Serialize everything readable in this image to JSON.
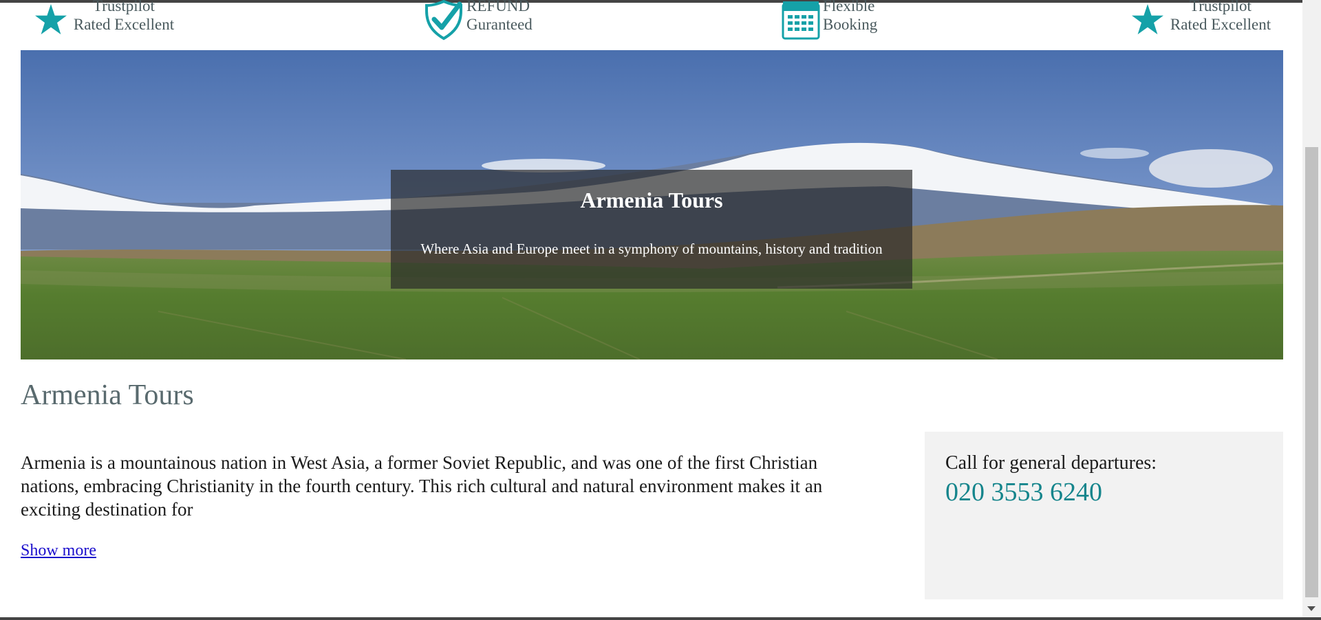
{
  "trust_bar": {
    "items": [
      {
        "icon": "star-icon",
        "line1": "Trustpilot",
        "line2": "Rated Excellent"
      },
      {
        "icon": "shield-check-icon",
        "line1": "REFUND",
        "line2": "Guranteed"
      },
      {
        "icon": "calendar-icon",
        "line1": "Flexible",
        "line2": "Booking"
      },
      {
        "icon": "star-icon",
        "line1": "Trustpilot",
        "line2": "Rated Excellent"
      }
    ],
    "accent_color": "#15a1a8"
  },
  "hero": {
    "title": "Armenia Tours",
    "subtitle": "Where Asia and Europe meet in a symphony of mountains, history and tradition"
  },
  "main": {
    "title": "Armenia Tours",
    "intro": "Armenia is a mountainous nation in West Asia, a former Soviet Republic, and was one of the first Christian nations, embracing Christianity in the fourth century. This rich cultural and natural environment makes it an exciting destination for",
    "show_more": "Show more"
  },
  "contact": {
    "label": "Call for general departures:",
    "phone": "020 3553 6240"
  }
}
